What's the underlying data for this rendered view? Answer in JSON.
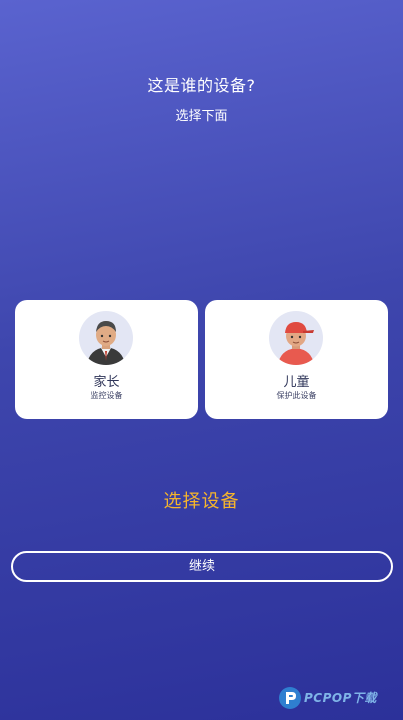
{
  "header": {
    "title": "这是谁的设备?",
    "subtitle": "选择下面"
  },
  "cards": [
    {
      "label": "家长",
      "sub": "监控设备",
      "avatar_icon": "parent-avatar-icon"
    },
    {
      "label": "儿童",
      "sub": "保护此设备",
      "avatar_icon": "child-avatar-icon"
    }
  ],
  "select_prompt": "选择设备",
  "continue_label": "继续",
  "watermark": {
    "text": "PCPOP下载"
  },
  "colors": {
    "accent": "#f6b52c",
    "background_top": "#5a63cf",
    "background_bottom": "#2c319a",
    "card": "#ffffff",
    "watermark": "#7fb4e8"
  }
}
